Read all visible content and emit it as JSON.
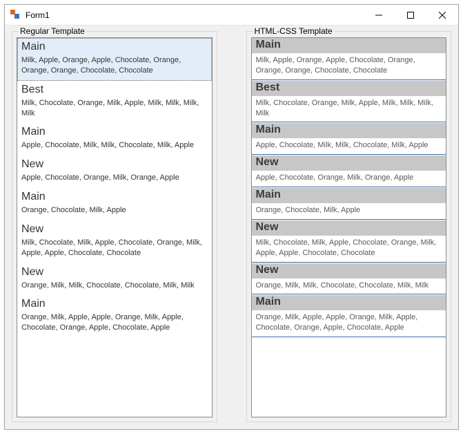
{
  "window": {
    "title": "Form1"
  },
  "panels": {
    "regular": {
      "legend": "Regular Template",
      "selected_index": 0,
      "items": [
        {
          "title": "Main",
          "desc": "Milk, Apple, Orange, Apple, Chocolate, Orange, Orange, Orange, Chocolate, Chocolate"
        },
        {
          "title": "Best",
          "desc": "Milk, Chocolate, Orange, Milk, Apple, Milk, Milk, Milk, Milk"
        },
        {
          "title": "Main",
          "desc": "Apple, Chocolate, Milk, Milk, Chocolate, Milk, Apple"
        },
        {
          "title": "New",
          "desc": "Apple, Chocolate, Orange, Milk, Orange, Apple"
        },
        {
          "title": "Main",
          "desc": "Orange, Chocolate, Milk, Apple"
        },
        {
          "title": "New",
          "desc": "Milk, Chocolate, Milk, Apple, Chocolate, Orange, Milk, Apple, Apple, Chocolate, Chocolate"
        },
        {
          "title": "New",
          "desc": "Orange, Milk, Milk, Chocolate, Chocolate, Milk, Milk"
        },
        {
          "title": "Main",
          "desc": "Orange, Milk, Apple, Apple, Orange, Milk, Apple, Chocolate, Orange, Apple, Chocolate, Apple"
        }
      ]
    },
    "htmlcss": {
      "legend": "HTML-CSS Template",
      "items": [
        {
          "title": "Main",
          "desc": "Milk, Apple, Orange, Apple, Chocolate, Orange, Orange, Orange, Chocolate, Chocolate"
        },
        {
          "title": "Best",
          "desc": "Milk, Chocolate, Orange, Milk, Apple, Milk, Milk, Milk, Milk"
        },
        {
          "title": "Main",
          "desc": "Apple, Chocolate, Milk, Milk, Chocolate, Milk, Apple"
        },
        {
          "title": "New",
          "desc": "Apple, Chocolate, Orange, Milk, Orange, Apple"
        },
        {
          "title": "Main",
          "desc": "Orange, Chocolate, Milk, Apple"
        },
        {
          "title": "New",
          "desc": "Milk, Chocolate, Milk, Apple, Chocolate, Orange, Milk, Apple, Apple, Chocolate, Chocolate"
        },
        {
          "title": "New",
          "desc": "Orange, Milk, Milk, Chocolate, Chocolate, Milk, Milk"
        },
        {
          "title": "Main",
          "desc": "Orange, Milk, Apple, Apple, Orange, Milk, Apple, Chocolate, Orange, Apple, Chocolate, Apple"
        }
      ]
    }
  }
}
